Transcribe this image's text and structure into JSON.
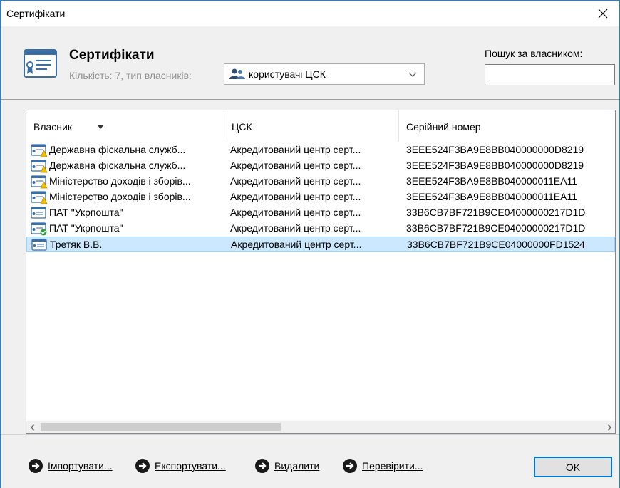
{
  "window": {
    "title": "Сертифікати"
  },
  "header": {
    "title": "Сертифікати",
    "subtitle": "Кількість: 7, тип власників:",
    "owner_type_selected": "користувачі ЦСК",
    "search_label": "Пошук за власником:",
    "search_value": ""
  },
  "table": {
    "columns": [
      "Власник",
      "ЦСК",
      "Серійний номер"
    ],
    "sort_column": "Власник",
    "rows": [
      {
        "owner": "Державна фіскальна служб...",
        "csk": "Акредитований центр серт...",
        "serial": "3EEE524F3BA9E8BB040000000D8219",
        "icon": "cert-warning-icon",
        "selected": false
      },
      {
        "owner": "Державна фіскальна служб...",
        "csk": "Акредитований центр серт...",
        "serial": "3EEE524F3BA9E8BB040000000D8219",
        "icon": "cert-warning-icon",
        "selected": false
      },
      {
        "owner": "Міністерство доходів і зборів...",
        "csk": "Акредитований центр серт...",
        "serial": "3EEE524F3BA9E8BB040000011EA11",
        "icon": "cert-warning-icon",
        "selected": false
      },
      {
        "owner": "Міністерство доходів і зборів...",
        "csk": "Акредитований центр серт...",
        "serial": "3EEE524F3BA9E8BB040000011EA11",
        "icon": "cert-warning-icon",
        "selected": false
      },
      {
        "owner": "ПАТ \"Укрпошта\"",
        "csk": "Акредитований центр серт...",
        "serial": "33B6CB7BF721B9CE04000000217D1D",
        "icon": "cert-icon",
        "selected": false
      },
      {
        "owner": "ПАТ \"Укрпошта\"",
        "csk": "Акредитований центр серт...",
        "serial": "33B6CB7BF721B9CE04000000217D1D",
        "icon": "cert-valid-icon",
        "selected": false
      },
      {
        "owner": "Третяк В.В.",
        "csk": "Акредитований центр серт...",
        "serial": "33B6CB7BF721B9CE04000000FD1524",
        "icon": "cert-icon",
        "selected": true
      }
    ]
  },
  "footer": {
    "actions": [
      "Імпортувати...",
      "Експортувати...",
      "Видалити",
      "Перевірити..."
    ],
    "ok_label": "OK"
  },
  "colors": {
    "accent": "#0078d7",
    "selection": "#cce8ff",
    "header_bg": "#f0f0f0"
  }
}
